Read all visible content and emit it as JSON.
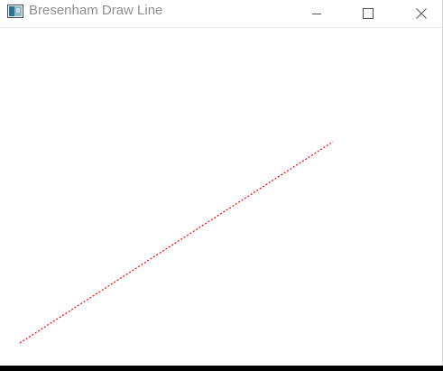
{
  "window": {
    "title": "Bresenham Draw Line"
  },
  "titlebar_buttons": {
    "minimize_icon": "minimize-icon",
    "maximize_icon": "maximize-icon",
    "close_icon": "close-icon"
  },
  "canvas": {
    "line_color": "#ff0000",
    "line_style": "dotted"
  }
}
